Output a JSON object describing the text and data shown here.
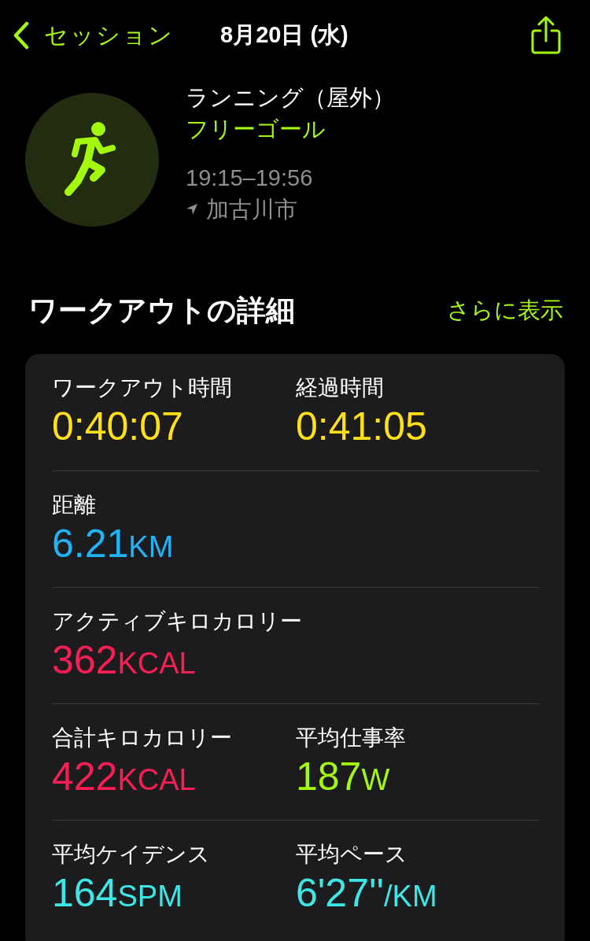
{
  "nav": {
    "back_label": "セッション",
    "title": "8月20日 (水)"
  },
  "workout": {
    "type": "ランニング（屋外）",
    "goal": "フリーゴール",
    "time_range": "19:15–19:56",
    "location": "加古川市"
  },
  "section": {
    "title": "ワークアウトの詳細",
    "more_link": "さらに表示"
  },
  "rows": [
    {
      "cells": [
        {
          "label": "ワークアウト時間",
          "value": "0:40:07",
          "color": "#ffe014"
        },
        {
          "label": "経過時間",
          "value": "0:41:05",
          "color": "#ffe014"
        }
      ]
    },
    {
      "cells": [
        {
          "label": "距離",
          "value": "6.21",
          "unit": "KM",
          "color": "#1fb4f8"
        }
      ]
    },
    {
      "cells": [
        {
          "label": "アクティブキロカロリー",
          "value": "362",
          "unit": "KCAL",
          "color": "#fa1e54"
        }
      ]
    },
    {
      "cells": [
        {
          "label": "合計キロカロリー",
          "value": "422",
          "unit": "KCAL",
          "color": "#fa1e54"
        },
        {
          "label": "平均仕事率",
          "value": "187",
          "unit": "W",
          "color": "#a4f80e"
        }
      ]
    },
    {
      "cells": [
        {
          "label": "平均ケイデンス",
          "value": "164",
          "unit": "SPM",
          "color": "#3ce8e6"
        },
        {
          "label": "平均ペース",
          "value": "6'27''",
          "unit": "/KM",
          "color": "#3ce8e6"
        }
      ]
    }
  ]
}
